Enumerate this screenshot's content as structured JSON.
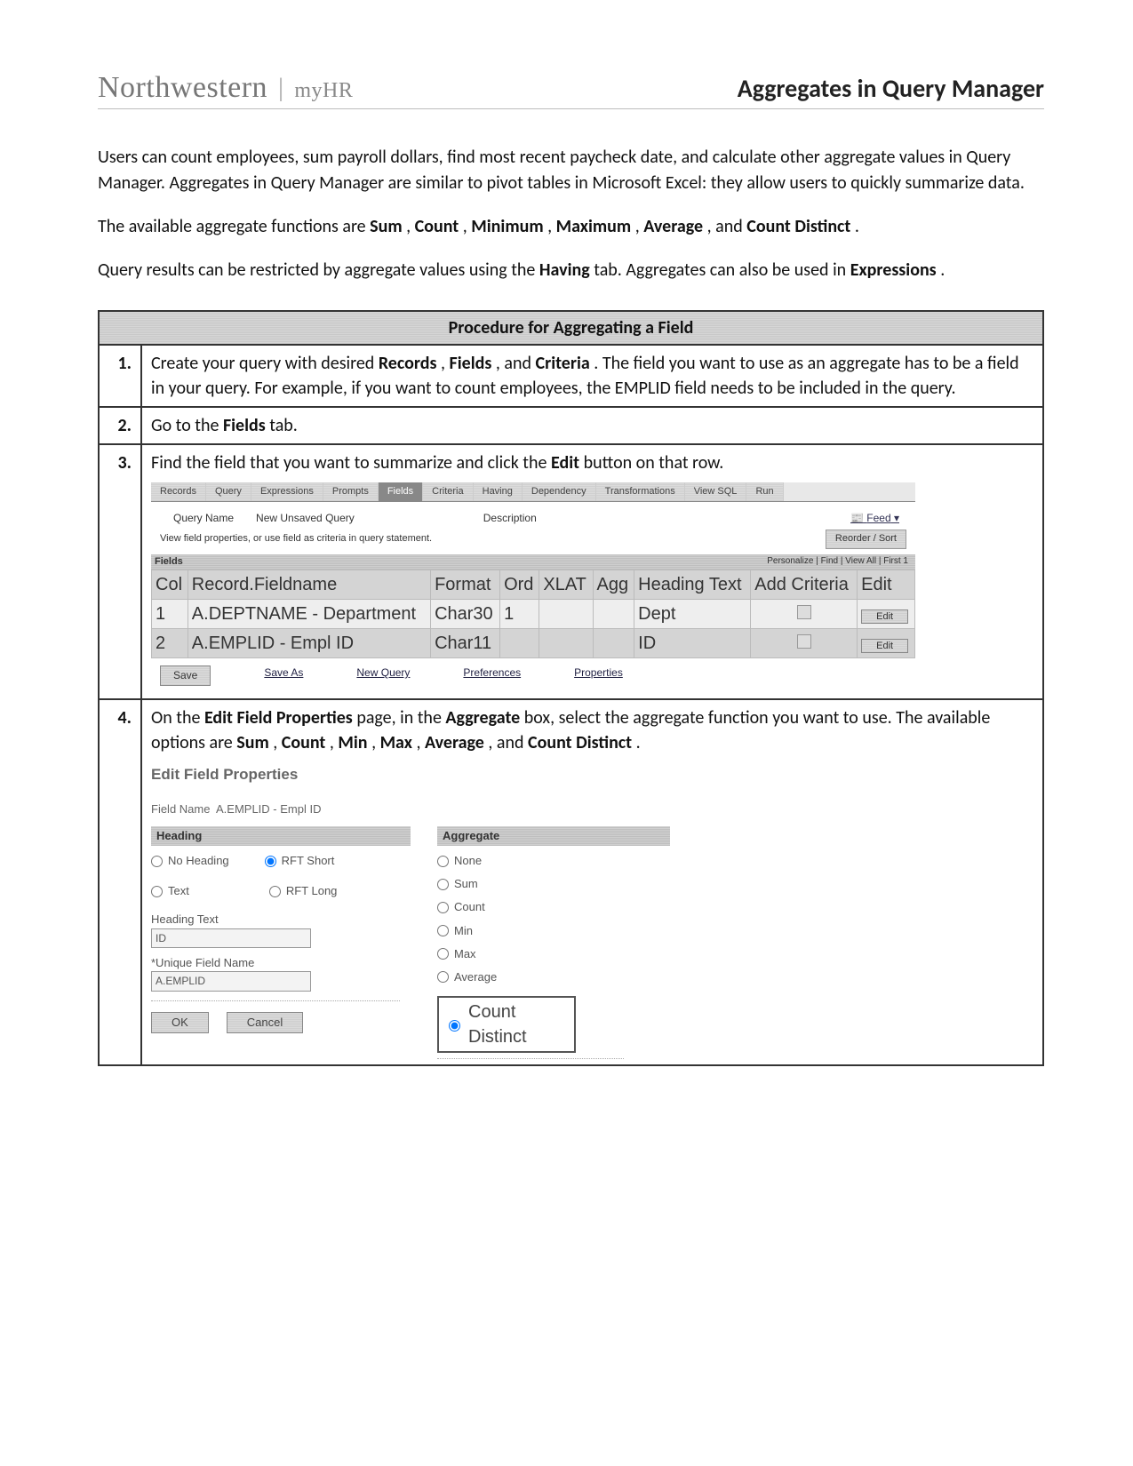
{
  "header": {
    "brand_main": "Northwestern",
    "brand_sub": "myHR",
    "title": "Aggregates in Query Manager"
  },
  "intro": {
    "p1": "Users can count employees, sum payroll dollars, find most recent paycheck date, and calculate other aggregate values in Query Manager. Aggregates in Query Manager are similar to pivot tables in Microsoft Excel: they allow users to quickly summarize data.",
    "p2_a": "The available aggregate functions are ",
    "p2_b": "Sum",
    "p2_c": ", ",
    "p2_d": "Count",
    "p2_e": ", ",
    "p2_f": "Minimum",
    "p2_g": ", ",
    "p2_h": "Maximum",
    "p2_i": ", ",
    "p2_j": "Average",
    "p2_k": ", and ",
    "p2_l": "Count Distinct",
    "p2_m": ".",
    "p3_a": "Query results can be restricted by aggregate values using the ",
    "p3_b": "Having",
    "p3_c": " tab. Aggregates can also be used in ",
    "p3_d": "Expressions",
    "p3_e": "."
  },
  "proc": {
    "title": "Procedure for Aggregating a Field",
    "s1": {
      "num": "1.",
      "a": "Create your query with desired ",
      "b": "Records",
      "c": ", ",
      "d": "Fields",
      "e": ", and ",
      "f": "Criteria",
      "g": ". The field you want to use as an aggregate has to be a field in your query. For example, if you want to count employees, the EMPLID field needs to be included in the query."
    },
    "s2": {
      "num": "2.",
      "a": "Go to the ",
      "b": "Fields",
      "c": " tab."
    },
    "s3": {
      "num": "3.",
      "a": "Find the field that you want to summarize and click the ",
      "b": "Edit",
      "c": " button on that row."
    },
    "s4": {
      "num": "4.",
      "a": "On the ",
      "b": "Edit Field Properties",
      "c": " page, in the ",
      "d": "Aggregate",
      "e": " box, select the aggregate function you want to use. The available options are ",
      "f": "Sum",
      "g": ", ",
      "h": "Count",
      "i": ", ",
      "j": "Min",
      "k": ", ",
      "l": "Max",
      "m": ", ",
      "n": "Average",
      "o": ", and ",
      "p": "Count Distinct",
      "q": "."
    }
  },
  "ss3": {
    "tabs": [
      "Records",
      "Query",
      "Expressions",
      "Prompts",
      "Fields",
      "Criteria",
      "Having",
      "Dependency",
      "Transformations",
      "View SQL",
      "Run"
    ],
    "active_tab_index": 4,
    "query_name_label": "Query Name",
    "query_name_value": "New Unsaved Query",
    "description_label": "Description",
    "feed": "Feed",
    "note": "View field properties, or use field as criteria in query statement.",
    "reorder": "Reorder / Sort",
    "band": "Fields",
    "band_right": "Personalize | Find | View All |   First  1",
    "cols": [
      "Col",
      "Record.Fieldname",
      "Format",
      "Ord",
      "XLAT",
      "Agg",
      "Heading Text",
      "Add Criteria",
      "Edit"
    ],
    "rows": [
      {
        "col": "1",
        "rf": "A.DEPTNAME - Department",
        "fmt": "Char30",
        "ord": "1",
        "xlat": "",
        "agg": "",
        "head": "Dept"
      },
      {
        "col": "2",
        "rf": "A.EMPLID - Empl ID",
        "fmt": "Char11",
        "ord": "",
        "xlat": "",
        "agg": "",
        "head": "ID"
      }
    ],
    "edit_btn": "Edit",
    "save": "Save",
    "saveas": "Save As",
    "newq": "New Query",
    "prefs": "Preferences",
    "props": "Properties"
  },
  "efp": {
    "title": "Edit Field Properties",
    "field_label": "Field Name",
    "field_value": "A.EMPLID - Empl ID",
    "heading": "Heading",
    "aggregate": "Aggregate",
    "no_heading": "No Heading",
    "rft_short": "RFT Short",
    "text": "Text",
    "rft_long": "RFT Long",
    "heading_text": "Heading Text",
    "heading_value": "ID",
    "unique_label": "*Unique Field Name",
    "unique_value": "A.EMPLID",
    "agg_none": "None",
    "agg_sum": "Sum",
    "agg_count": "Count",
    "agg_min": "Min",
    "agg_max": "Max",
    "agg_avg": "Average",
    "agg_cd": "Count Distinct",
    "ok": "OK",
    "cancel": "Cancel"
  }
}
